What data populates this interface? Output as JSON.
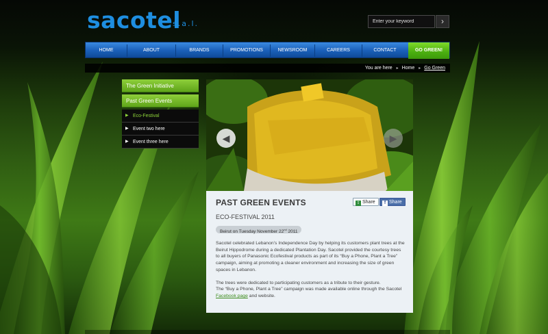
{
  "brand": {
    "name": "sacotel",
    "suffix": "s.a.l.",
    "color": "#1e8ee0"
  },
  "search": {
    "placeholder": "Enter your keyword",
    "button_icon": "arrow-right-icon"
  },
  "nav": {
    "items": [
      "HOME",
      "ABOUT",
      "BRANDS",
      "PROMOTIONS",
      "NEWSROOM",
      "CAREERS",
      "CONTACT",
      "GO GREEN!"
    ],
    "active_color": "#4bae10",
    "base_color": "#1a5fb8"
  },
  "breadcrumb": {
    "prefix": "You are here",
    "items": [
      "Home",
      "Go Green"
    ]
  },
  "sidebar": {
    "sections": [
      "The Green Initiative",
      "Past Green Events"
    ],
    "items": [
      "Eco-Festival",
      "Event two here",
      "Event three here"
    ],
    "active_item": "Eco-Festival",
    "accent": "#8fd63a"
  },
  "slider": {
    "prev_icon": "chevron-left-icon",
    "next_icon": "chevron-right-icon"
  },
  "article": {
    "heading": "PAST GREEN EVENTS",
    "share_label": "Share",
    "facebook_share_label": "Share",
    "event_title": "ECO-FESTIVAL 2011",
    "date_prefix": "Beirut on Tuesday November 22",
    "date_suffix": "nd",
    "date_year": " 2011",
    "paragraph1": "Sacotel celebrated Lebanon’s Independence Day by helping its customers plant trees at the Beirut Hippodrome during a dedicated Plantation Day. Sacotel provided the courtesy trees to all buyers of Panasonic Ecofestival products as part of its “Buy a Phone, Plant a Tree” campaign, aiming at promoting a cleaner environment and increasing the size of green spaces in Lebanon.",
    "paragraph2_line1": "The trees were dedicated to participating customers as a tribute to their gesture.",
    "paragraph2_line2": "The “Buy a Phone, Plant a Tree” campaign was made available online through the Sacotel",
    "facebook_link": "Facebook page",
    "paragraph2_end": "and website."
  }
}
